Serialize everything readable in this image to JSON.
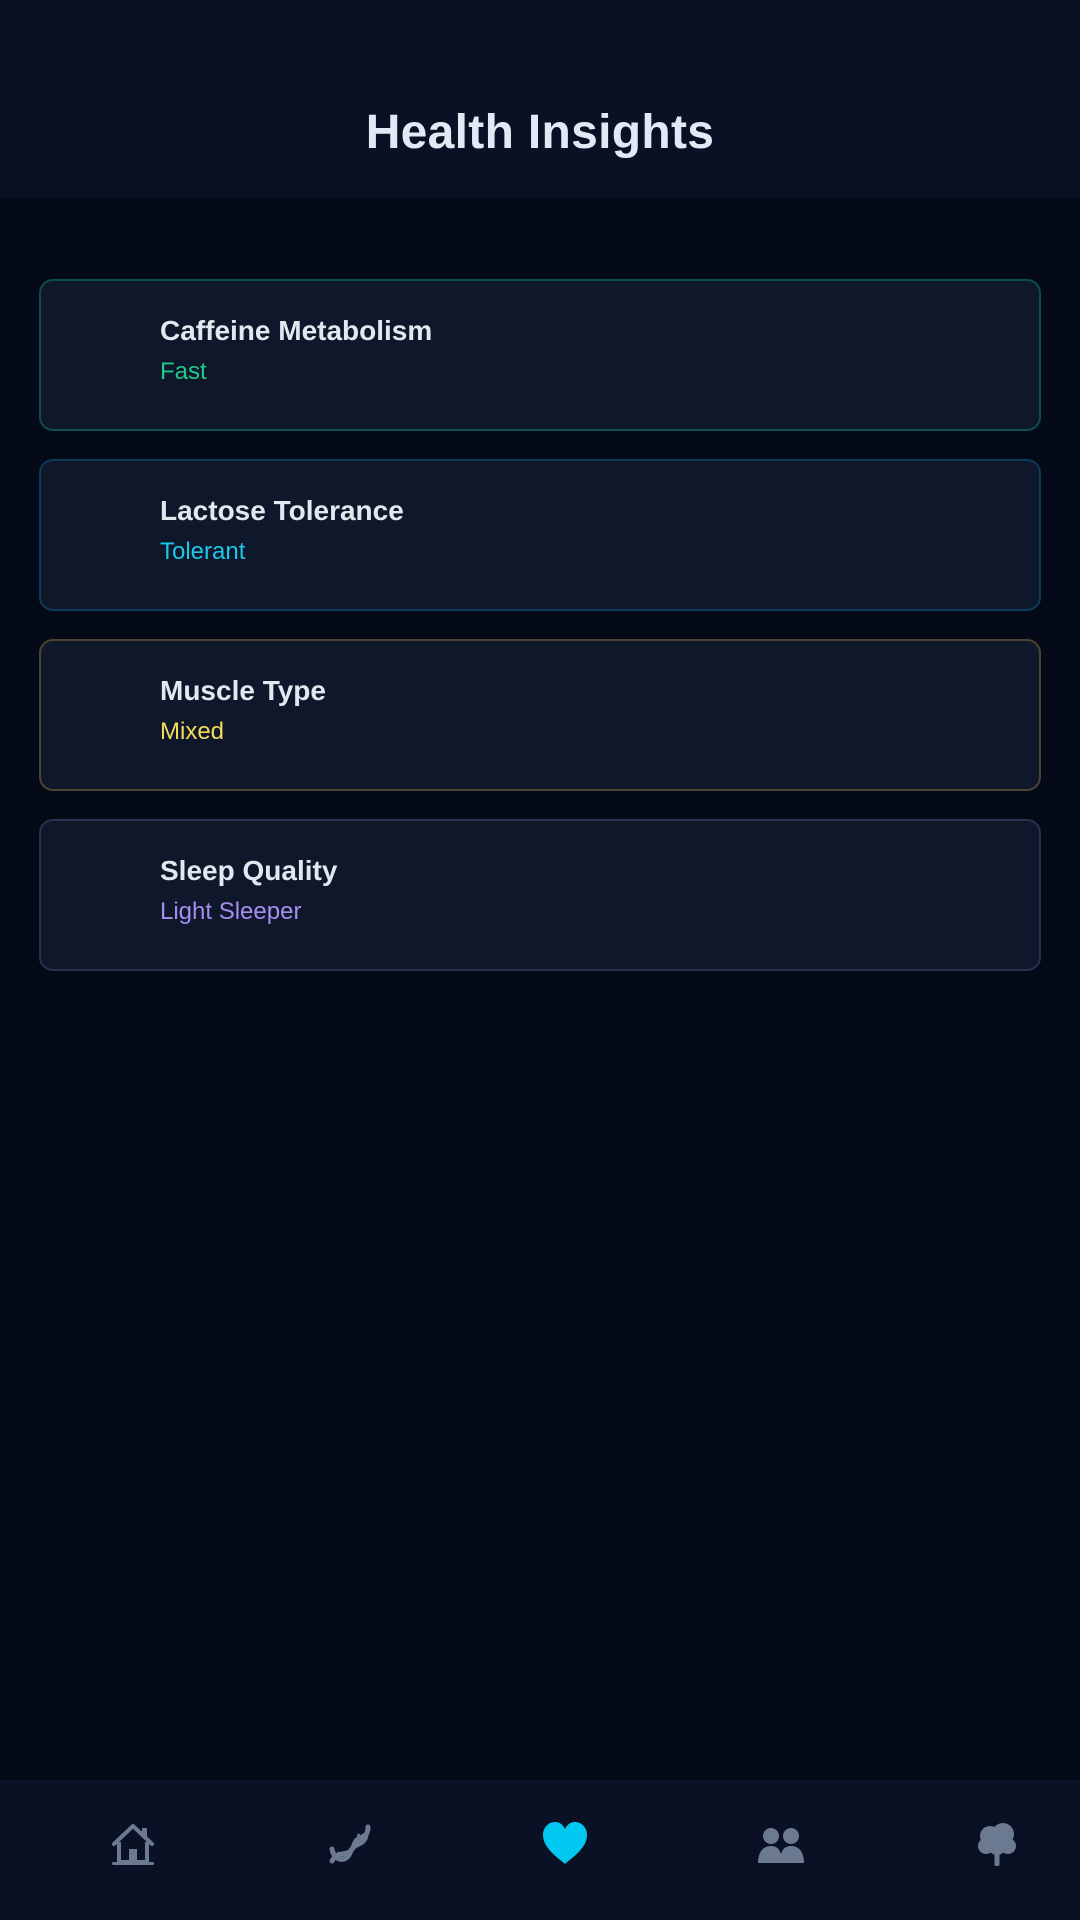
{
  "header": {
    "title": "Health Insights"
  },
  "insights": [
    {
      "title": "Caffeine Metabolism",
      "value": "Fast",
      "accent": "#22c98a"
    },
    {
      "title": "Lactose Tolerance",
      "value": "Tolerant",
      "accent": "#1cc7e8"
    },
    {
      "title": "Muscle Type",
      "value": "Mixed",
      "accent": "#f2dc5a"
    },
    {
      "title": "Sleep Quality",
      "value": "Light Sleeper",
      "accent": "#a48ff0"
    }
  ],
  "bottom_nav": {
    "items": [
      {
        "icon": "home-icon",
        "active": false
      },
      {
        "icon": "dna-icon",
        "active": false
      },
      {
        "icon": "heart-icon",
        "active": true
      },
      {
        "icon": "people-icon",
        "active": false
      },
      {
        "icon": "tree-icon",
        "active": false
      }
    ],
    "active_color": "#00c8f0",
    "inactive_color": "#6b7a90"
  }
}
